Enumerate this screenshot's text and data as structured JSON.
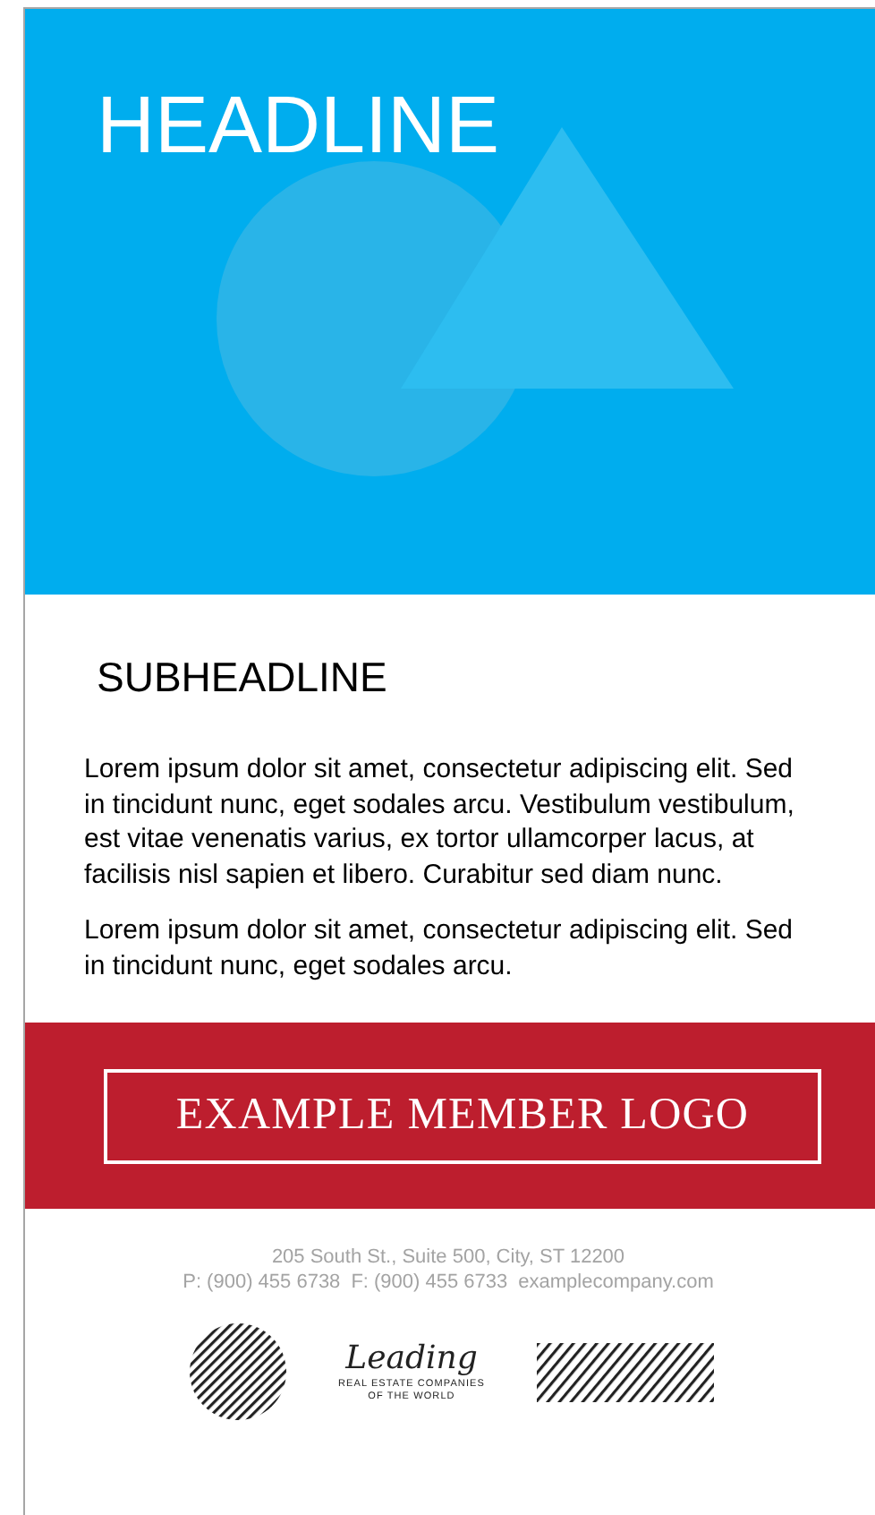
{
  "hero": {
    "headline": "HEADLINE"
  },
  "subheadline": "SUBHEADLINE",
  "paragraphs": [
    "Lorem ipsum dolor sit amet, consectetur adipiscing elit. Sed in tincidunt nunc, eget sodales arcu. Vestibulum vestibulum, est vitae venenatis varius, ex tortor ullamcorper lacus, at facilisis nisl sapien et libero. Curabitur sed diam nunc.",
    "Lorem ipsum dolor sit amet, consectetur adipiscing elit. Sed in tincidunt nunc, eget sodales arcu."
  ],
  "member_logo": "EXAMPLE MEMBER LOGO",
  "contact": {
    "address": "205 South St., Suite 500, City, ST 12200",
    "phone": "P: (900) 455 6738",
    "fax": "F: (900) 455 6733",
    "website": "examplecompany.com"
  },
  "leading_logo": {
    "script": "Leading",
    "line_1": "REAL ESTATE COMPANIES",
    "line_2": "OF THE WORLD"
  }
}
